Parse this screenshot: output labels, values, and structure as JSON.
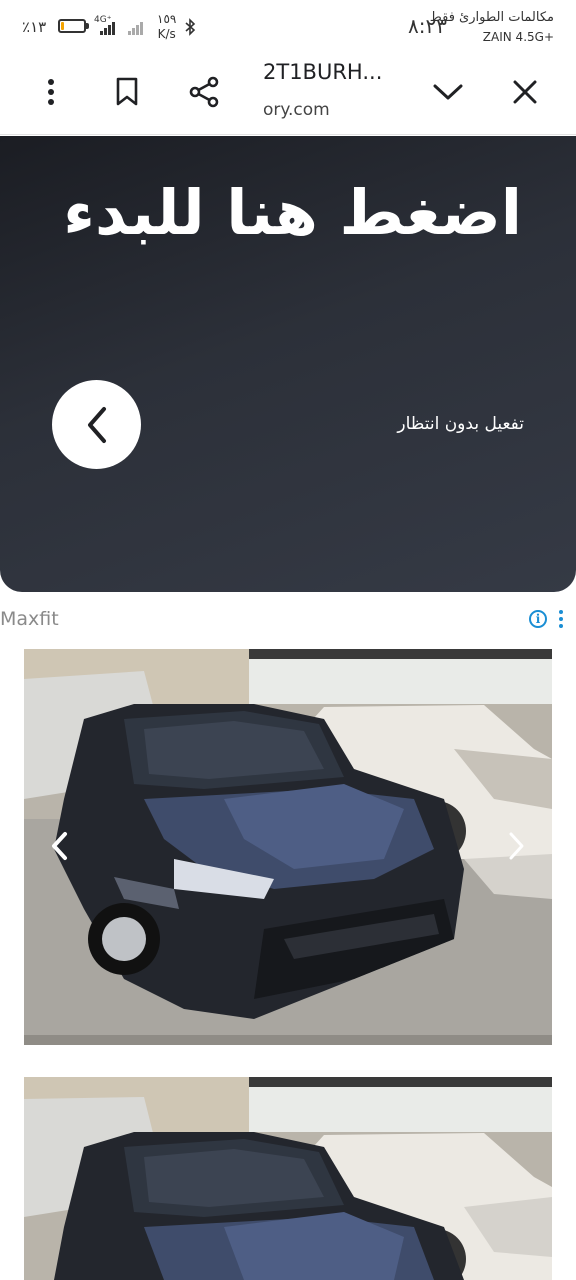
{
  "status_bar": {
    "battery_percent": "٪١٣",
    "battery_level": 0.13,
    "network_type": "4G⁺",
    "data_speed_value": "١٥٩",
    "data_speed_unit": "K/s",
    "time": "٨:٢٣",
    "carrier_line1": "مكالمات الطوارئ فقط",
    "carrier_line2": "ZAIN 4.5G+"
  },
  "browser": {
    "page_title": "2T1BURH...",
    "url": "ory.com",
    "icons": [
      "more-vert-icon",
      "bookmark-icon",
      "share-icon",
      "chevron-down-icon",
      "close-icon"
    ]
  },
  "hero": {
    "headline": "اضغط هنا للبدء",
    "subtext": "تفعيل بدون انتظار",
    "icon": "chevron-left-icon"
  },
  "ad": {
    "label": "Maxfit",
    "accent_color": "#1a8ed4"
  },
  "gallery": {
    "icons": [
      "gallery-prev-icon",
      "gallery-next-icon"
    ]
  },
  "colors": {
    "hero_bg": "#2c3039",
    "battery_fill": "#f4a300"
  }
}
